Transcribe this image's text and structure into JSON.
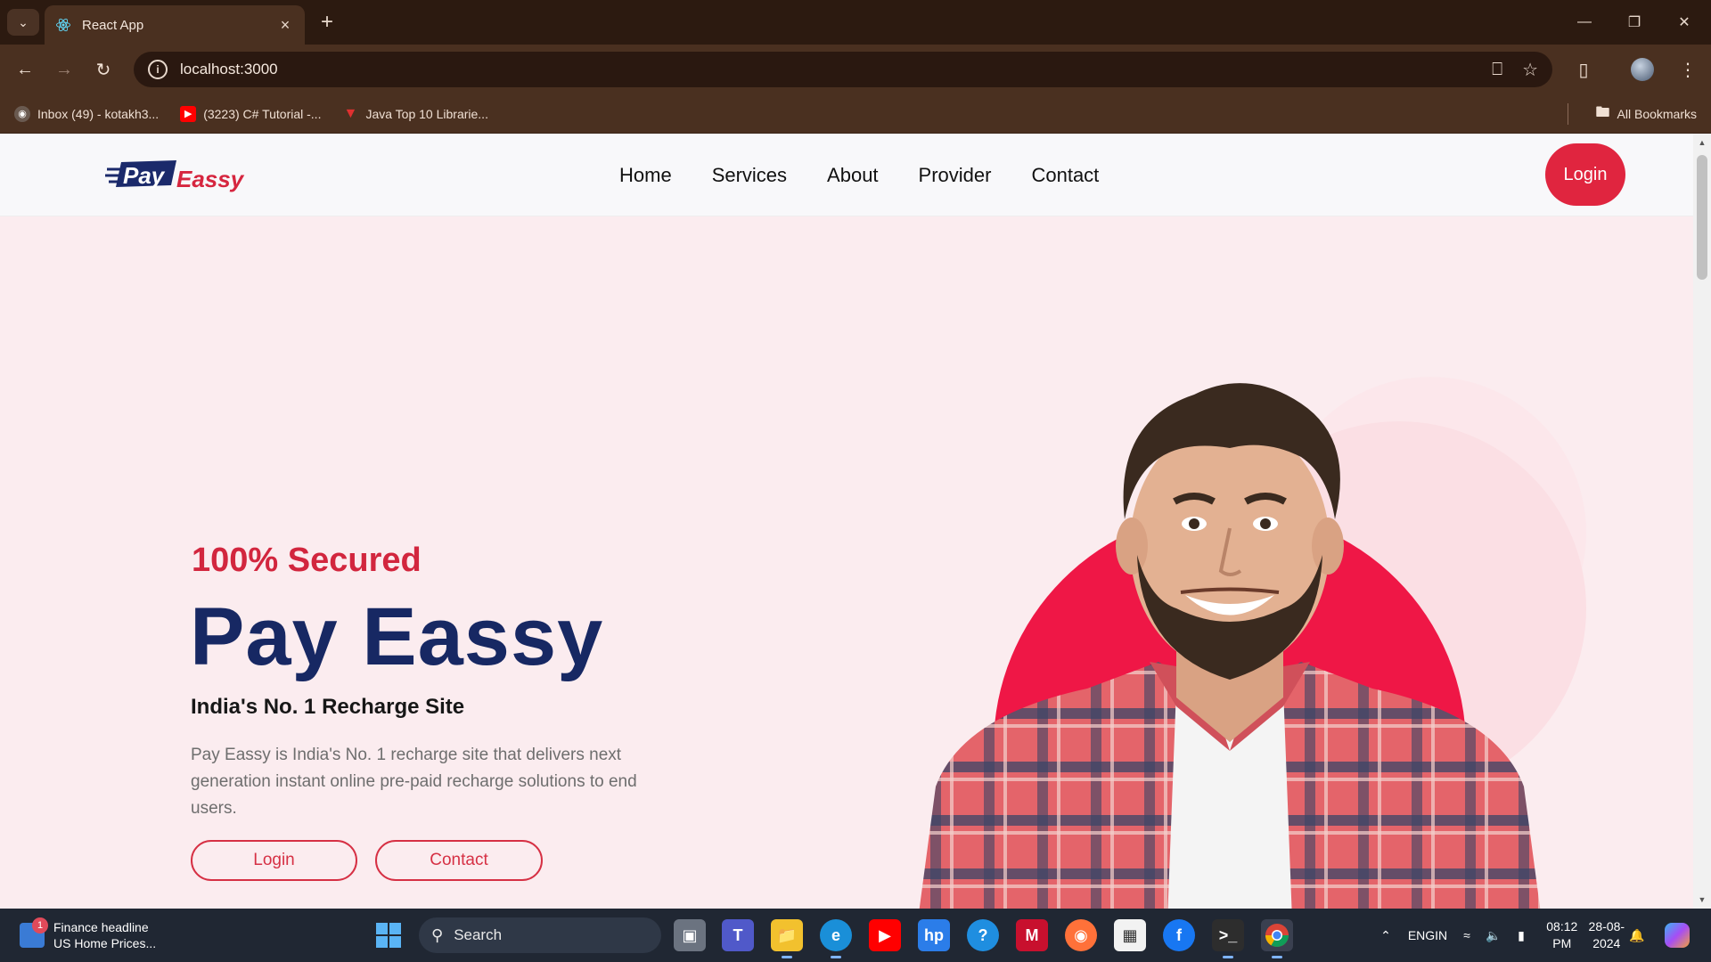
{
  "browser": {
    "tab_title": "React App",
    "url": "localhost:3000",
    "bookmarks": [
      {
        "label": "Inbox (49) - kotakh3..."
      },
      {
        "label": "(3223) C# Tutorial -..."
      },
      {
        "label": "Java Top 10 Librarie..."
      }
    ],
    "all_bookmarks": "All Bookmarks"
  },
  "site": {
    "logo": {
      "part1": "Pay",
      "part2": "Eassy"
    },
    "nav": [
      "Home",
      "Services",
      "About",
      "Provider",
      "Contact"
    ],
    "login_button": "Login"
  },
  "hero": {
    "eyebrow": "100% Secured",
    "headline": "Pay Eassy",
    "tagline": "India's No. 1 Recharge Site",
    "description": "Pay Eassy is India's No. 1 recharge site that delivers next generation instant online pre-paid recharge solutions to end users.",
    "login_button": "Login",
    "contact_button": "Contact"
  },
  "taskbar": {
    "widget_title": "Finance headline",
    "widget_subtitle": "US Home Prices...",
    "widget_badge": "1",
    "search_placeholder": "Search",
    "lang_top": "ENG",
    "lang_bottom": "IN",
    "time": "08:12 PM",
    "date": "28-08-2024"
  },
  "colors": {
    "accent_red": "#e0253f",
    "navy": "#172863",
    "hero_bg": "#fbecef"
  }
}
